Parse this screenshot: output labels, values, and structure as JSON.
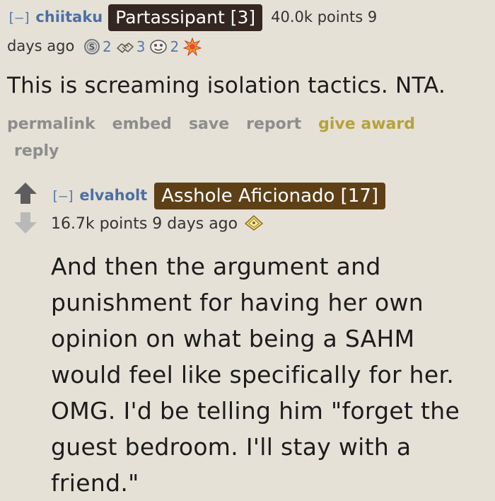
{
  "comment1": {
    "expand": "[–]",
    "author": "chiitaku",
    "flair": "Partassipant [3]",
    "points": "40.0k points 9",
    "time": "days ago",
    "awards": [
      {
        "icon": "silver-coin-icon",
        "count": "2"
      },
      {
        "icon": "handshake-icon",
        "count": "3"
      },
      {
        "icon": "face-award-icon",
        "count": "2"
      },
      {
        "icon": "starburst-award-icon",
        "count": ""
      }
    ],
    "body": "This is screaming isolation tactics. NTA.",
    "buttons": {
      "permalink": "permalink",
      "embed": "embed",
      "save": "save",
      "report": "report",
      "give_award": "give award",
      "reply": "reply"
    }
  },
  "comment2": {
    "expand": "[–]",
    "author": "elvaholt",
    "flair": "Asshole Aficionado [17]",
    "points_time": "16.7k points 9 days ago",
    "award_icon": "helpful-award-icon",
    "body": "And then the argument and punishment for having her own opinion on what being a SAHM would feel like specifically for her. OMG. I'd be telling him \"forget the guest bedroom. I'll stay with a friend.\""
  },
  "colors": {
    "background": "#e6e1d7",
    "author": "#4d6fa3",
    "flair1": "#342620",
    "flair2": "#5e4017",
    "give_award": "#b7a23a",
    "buttons": "#8d8d8d"
  }
}
